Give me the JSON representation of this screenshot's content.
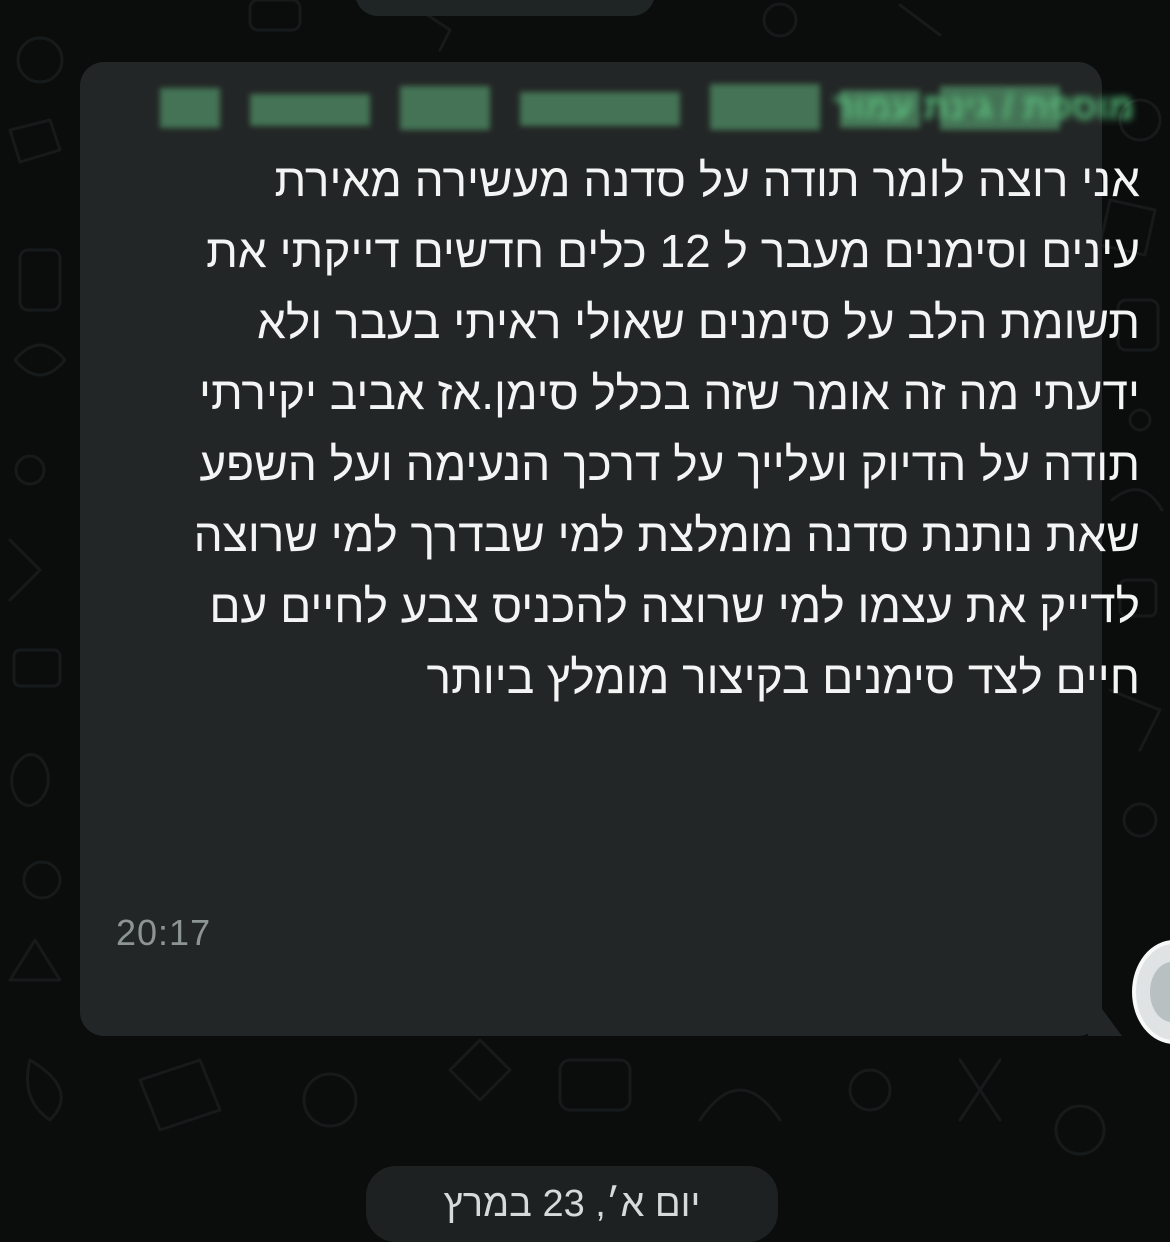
{
  "chat": {
    "sender_name": "מוספת / גינת עמור",
    "message_text": "אני רוצה לומר תודה על סדנה מעשירה מאירת עינים וסימנים מעבר ל 12 כלים חדשים דייקתי את תשומת הלב על סימנים שאולי ראיתי בעבר ולא ידעתי מה זה אומר שזה בכלל סימן.אז אביב יקירתי תודה על הדיוק ועלייך על דרכך הנעימה ועל השפע שאת נותנת סדנה מומלצת למי שבדרך למי שרוצה לדייק את עצמו למי שרוצה להכניס צבע לחיים עם חיים לצד סימנים בקיצור מומלץ ביותר",
    "timestamp": "20:17",
    "date_separator": "יום א׳, 23 במרץ"
  },
  "colors": {
    "background": "#0b0d0d",
    "bubble": "#232626",
    "sender_name": "#58c27d",
    "message_text": "#f3f4f4",
    "timestamp": "#8c9494"
  },
  "icons": {
    "avatar": "user-avatar"
  }
}
